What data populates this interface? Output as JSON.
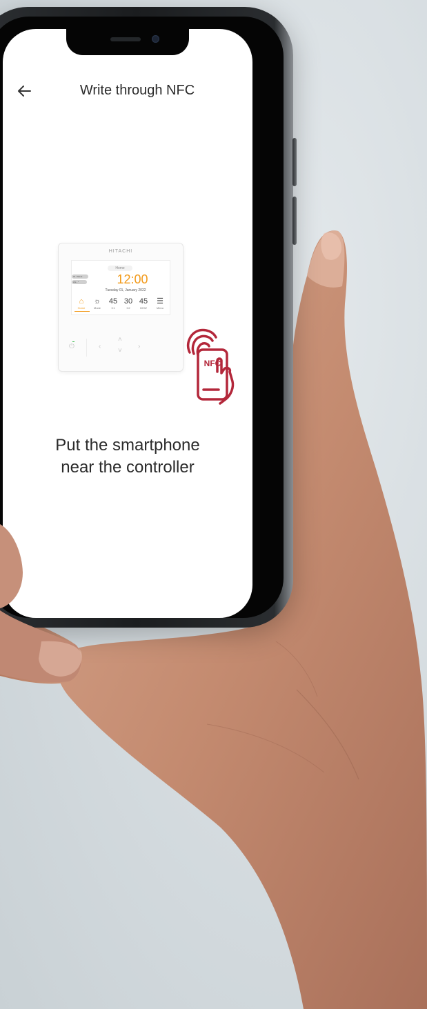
{
  "app": {
    "title": "Write through NFC",
    "back_icon": "arrow-left-icon"
  },
  "controller": {
    "brand": "HITACHI",
    "screen_tab": "Home",
    "pill1": "01 / Silent",
    "pill2": "HS • *",
    "time": "12:00",
    "date": "Tuesday 01, January 2022",
    "items": [
      {
        "value": "⌂",
        "label": "Home",
        "icon": "home-icon"
      },
      {
        "value": "☼",
        "label": "Mode",
        "icon": "sun-icon"
      },
      {
        "value": "45",
        "label": "C1"
      },
      {
        "value": "30",
        "label": "C2"
      },
      {
        "value": "45",
        "label": "DHW"
      },
      {
        "value": "☰",
        "label": "Menu",
        "icon": "menu-icon"
      }
    ],
    "nfc_label": "NFC"
  },
  "instruction": {
    "line1": "Put the smartphone",
    "line2": "near the controller"
  },
  "colors": {
    "accent_orange": "#f29a1a",
    "nfc_red": "#b3273a",
    "background": "#d9e0e4",
    "skin": "#c8927a"
  }
}
